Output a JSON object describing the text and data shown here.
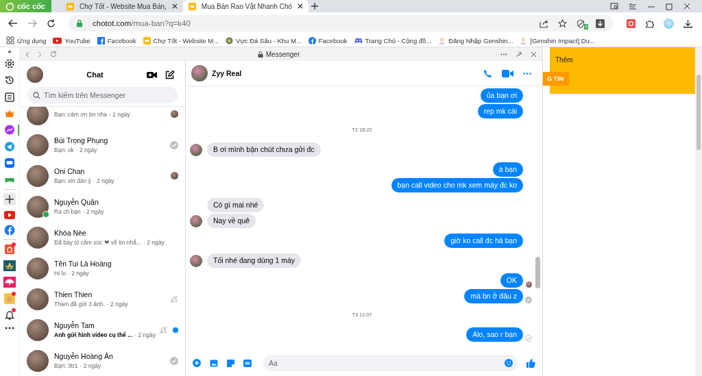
{
  "browser": {
    "logo": "cốc cốc",
    "tabs": [
      {
        "title": "Chợ Tốt - Website Mua Bán,",
        "selected": false
      },
      {
        "title": "Mua Bán Rao Vặt Nhanh Chó",
        "selected": true
      }
    ],
    "url_host": "chotot.com",
    "url_path": "/mua-ban?q=k40",
    "shield_badge": "3"
  },
  "bookmarks": [
    {
      "kind": "apps",
      "label": "Ứng dụng"
    },
    {
      "kind": "youtube",
      "label": "YouTube"
    },
    {
      "kind": "facebook-square",
      "label": "Facebook"
    },
    {
      "kind": "chotot",
      "label": "Chợ Tốt - Website M..."
    },
    {
      "kind": "globe",
      "label": "Vực Đá Sâu - Khu M..."
    },
    {
      "kind": "facebook",
      "label": "Facebook"
    },
    {
      "kind": "controller",
      "label": "Trang Chủ - Cộng đồ..."
    },
    {
      "kind": "character",
      "label": "Đăng Nhập Genshin..."
    },
    {
      "kind": "character",
      "label": "[Genshin Impact] Du..."
    }
  ],
  "sidebar": [
    {
      "kind": "gear",
      "selected": false,
      "badge": false
    },
    {
      "kind": "history",
      "selected": false,
      "badge": false
    },
    {
      "kind": "list",
      "selected": false,
      "badge": false
    },
    {
      "kind": "crown",
      "selected": false,
      "badge": false
    },
    {
      "kind": "messenger",
      "selected": true,
      "badge": false
    },
    {
      "kind": "telegram",
      "selected": false,
      "badge": false
    },
    {
      "kind": "zalo",
      "selected": false,
      "badge": false
    },
    {
      "kind": "gamepad",
      "selected": false,
      "badge": false
    },
    {
      "kind": "plus",
      "selected": false,
      "badge": false
    },
    {
      "kind": "youtube",
      "selected": false,
      "badge": false
    },
    {
      "kind": "facebook",
      "selected": false,
      "badge": false
    },
    {
      "kind": "shop",
      "selected": false,
      "badge": true
    },
    {
      "kind": "lotus",
      "selected": false,
      "badge": false
    },
    {
      "kind": "umbrella",
      "selected": false,
      "badge": false
    },
    {
      "kind": "game",
      "selected": false,
      "badge": true
    },
    {
      "kind": "bell",
      "selected": false,
      "badge": true
    },
    {
      "kind": "more",
      "selected": false,
      "badge": false
    }
  ],
  "panel": {
    "title": "Messenger"
  },
  "chat_list": {
    "title": "Chat",
    "search": {
      "placeholder": "Tìm kiếm trên Messenger"
    },
    "items": [
      {
        "preview": "Bạn: cảm ơn bn nha",
        "time": "· 1 ngày",
        "seen": true,
        "delivered": false,
        "muted": false,
        "unread": false,
        "online": false
      },
      {
        "name": "Bùi Trọng Phụng",
        "preview": "Bạn: ok",
        "time": "· 2 ngày",
        "seen": false,
        "delivered": true,
        "muted": false,
        "unread": false,
        "online": false
      },
      {
        "name": "Oni Chan",
        "preview": "Bạn: xin dàn ý",
        "time": "· 2 ngày",
        "seen": true,
        "delivered": false,
        "muted": false,
        "unread": false,
        "online": false
      },
      {
        "name": "Nguyễn Quân",
        "preview": "Ra ch bạn",
        "time": "· 2 ngày",
        "seen": false,
        "delivered": false,
        "muted": false,
        "unread": false,
        "online": true
      },
      {
        "name": "Khóa Nèe",
        "preview": "Đã bày tỏ cảm xúc ❤ về tin nhắ...",
        "time": "· 2 ngày",
        "seen": false,
        "delivered": false,
        "muted": false,
        "unread": false,
        "online": false
      },
      {
        "name": "Tên Tui Là Hoàng",
        "preview": "Hi lo",
        "time": "· 2 ngày",
        "seen": false,
        "delivered": false,
        "muted": false,
        "unread": false,
        "online": false
      },
      {
        "name": "Thien Thien",
        "preview": "Thien đã gửi 3 ảnh.",
        "time": "· 2 ngày",
        "seen": false,
        "delivered": false,
        "muted": true,
        "unread": false,
        "online": false
      },
      {
        "name": "Nguyễn Tam",
        "preview": "Anh gửi hình video cụ thể ...",
        "time": "· 2 ngày",
        "seen": false,
        "delivered": false,
        "muted": true,
        "unread": true,
        "online": false
      },
      {
        "name": "Nguyễn Hoàng Ân",
        "preview": "Bạn: 3tr1",
        "time": "· 2 ngày",
        "seen": false,
        "delivered": true,
        "muted": false,
        "unread": false,
        "online": false
      }
    ]
  },
  "conversation": {
    "name": "Zyy Real",
    "messages": [
      {
        "kind": "out",
        "text": "ủa bạn ơi",
        "seen": false,
        "delivered": false,
        "sent": false
      },
      {
        "kind": "out",
        "text": "rep mk cái",
        "seen": false,
        "delivered": false,
        "sent": false
      },
      {
        "kind": "time",
        "text": "T2 18:22"
      },
      {
        "kind": "in",
        "text": "B ơi mình bận chút chưa gửi đc",
        "avatar": true
      },
      {
        "kind": "out",
        "text": "à bạn",
        "seen": false,
        "delivered": false,
        "sent": false
      },
      {
        "kind": "out",
        "text": "bạn call video cho mk xem máy đc ko",
        "seen": false,
        "delivered": false,
        "sent": false
      },
      {
        "kind": "in",
        "text": "Có gì mai nhé",
        "avatar": false
      },
      {
        "kind": "in",
        "text": "Nay về quê",
        "avatar": true
      },
      {
        "kind": "out",
        "text": "giờ ko call đc hả bạn",
        "seen": false,
        "delivered": false,
        "sent": false
      },
      {
        "kind": "in",
        "text": "Tối nhé đang dùng 1 máy",
        "avatar": true
      },
      {
        "kind": "out",
        "text": "OK",
        "seen": true,
        "delivered": false,
        "sent": false
      },
      {
        "kind": "out",
        "text": "mà bn ở đâu z",
        "seen": false,
        "delivered": true,
        "sent": false
      },
      {
        "kind": "time",
        "text": "T3 11:07"
      },
      {
        "kind": "out",
        "text": "Alo, sao r bạn",
        "seen": false,
        "delivered": false,
        "sent": true
      }
    ],
    "composer": {
      "placeholder": "Aa"
    }
  },
  "page": {
    "link": "Thêm",
    "button": "G TIN"
  }
}
